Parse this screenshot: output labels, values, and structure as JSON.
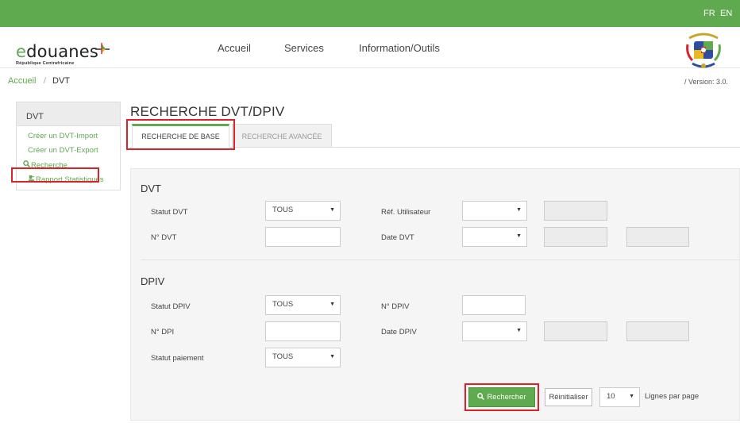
{
  "topbar": {
    "lang_fr": "FR",
    "lang_en": "EN"
  },
  "brand": {
    "logo_e": "e",
    "logo_rest": "douanes",
    "subtitle": "République Centrafricaine"
  },
  "nav": {
    "home": "Accueil",
    "services": "Services",
    "info": "Information/Outils"
  },
  "breadcrumb": {
    "home": "Accueil",
    "sep": "/",
    "current": "DVT"
  },
  "version": "/ Version: 3.0.",
  "sidebar": {
    "title": "DVT",
    "items": [
      {
        "label": "Créer un DVT-Import",
        "icon": ""
      },
      {
        "label": "Créer un DVT-Export",
        "icon": ""
      },
      {
        "label": "Recherche",
        "icon": "search-icon"
      },
      {
        "label": "Rapport Statistiques",
        "icon": "report-icon"
      }
    ]
  },
  "page_title": "RECHERCHE DVT/DPIV",
  "tabs": {
    "basic": "RECHERCHE DE BASE",
    "advanced": "RECHERCHE AVANCÉE"
  },
  "dvt": {
    "title": "DVT",
    "statut_label": "Statut DVT",
    "statut_value": "TOUS",
    "ref_label": "Réf. Utilisateur",
    "num_label": "N° DVT",
    "num_value": "",
    "date_label": "Date DVT"
  },
  "dpiv": {
    "title": "DPIV",
    "statut_label": "Statut DPIV",
    "statut_value": "TOUS",
    "num_label": "N° DPIV",
    "num_value": "",
    "dpi_label": "N° DPI",
    "dpi_value": "",
    "date_label": "Date DPIV",
    "paiement_label": "Statut paiement",
    "paiement_value": "TOUS"
  },
  "actions": {
    "search": "Rechercher",
    "reset": "Réinitialiser",
    "page_size": "10",
    "page_size_label": "Lignes par page"
  },
  "colors": {
    "brand_green": "#5fa94f",
    "highlight_red": "#d9232a"
  }
}
